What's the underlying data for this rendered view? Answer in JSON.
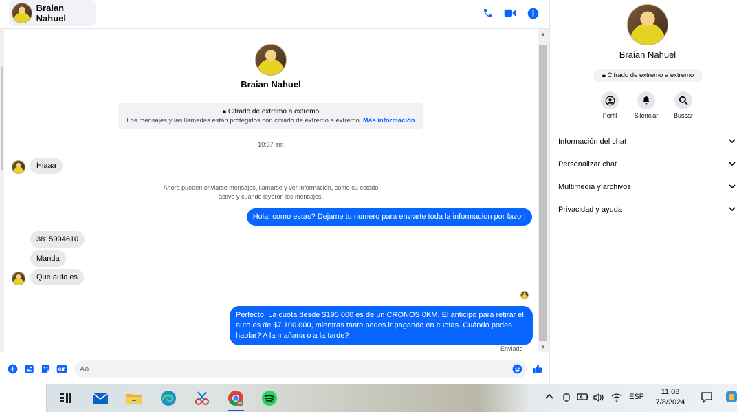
{
  "header": {
    "contact_name": "Braian Nahuel"
  },
  "conversation": {
    "contact_name": "Braian Nahuel",
    "e2e_title": "Cifrado de extremo a extremo",
    "e2e_desc": "Los mensajes y las llamadas están protegidos con cifrado de extremo a extremo.",
    "e2e_link": "Más información",
    "timestamp": "10:37 am",
    "system_note_line1": "Ahora pueden enviarse mensajes, llamarse y ver información, como su estado",
    "system_note_line2": "activo y cuándo leyeron los mensajes.",
    "messages": [
      {
        "dir": "in",
        "text": "Hiaaa"
      },
      {
        "dir": "out",
        "text": "Hola! como estas? Dejame tu numero para enviarte toda la informacion por favor!"
      },
      {
        "dir": "in",
        "text": "3815994610"
      },
      {
        "dir": "in",
        "text": "Manda"
      },
      {
        "dir": "in",
        "text": "Que auto es"
      },
      {
        "dir": "out",
        "text": "Perfecto! La cuota desde $195.000 es de un CRONOS 0KM. El anticipo para retirar el auto es de $7.100.000, mientras tanto podes ir pagando en cuotas. Cuándo podes hablar? A la mañana o a la tarde?"
      }
    ],
    "status": "Enviado"
  },
  "composer": {
    "placeholder": "Aa"
  },
  "info_panel": {
    "contact_name": "Braian Nahuel",
    "badge": "Cifrado de extremo a extremo",
    "actions": [
      {
        "label": "Perfil",
        "icon": "profile-icon"
      },
      {
        "label": "Silenciar",
        "icon": "bell-icon"
      },
      {
        "label": "Buscar",
        "icon": "search-icon"
      }
    ],
    "sections": [
      {
        "label": "Información del chat"
      },
      {
        "label": "Personalizar chat"
      },
      {
        "label": "Multimedia y archivos"
      },
      {
        "label": "Privacidad y ayuda"
      }
    ]
  },
  "taskbar": {
    "language": "ESP",
    "time": "11:08",
    "date": "7/8/2024"
  },
  "colors": {
    "accent": "#0866ff",
    "incoming_bubble": "#e9e9eb",
    "panel_bg": "#f0f2f5"
  }
}
